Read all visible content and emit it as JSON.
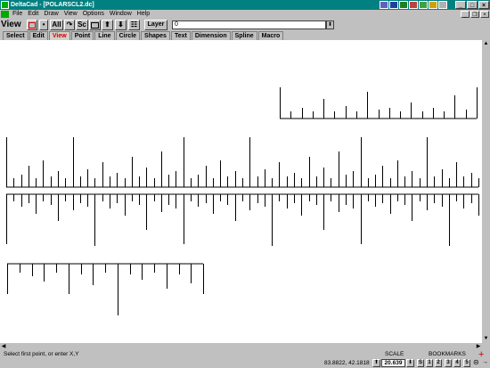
{
  "window": {
    "title": "DeltaCad - [POLARSCL2.dc]"
  },
  "menu": [
    "File",
    "Edit",
    "Draw",
    "View",
    "Options",
    "Window",
    "Help"
  ],
  "toolbar": {
    "mode_label": "View",
    "all_label": "All",
    "sc_label": "Sc",
    "layer_label": "Layer",
    "layer_value": "0",
    "dropdown_glyph": "⬍",
    "up_glyph": "⬆",
    "down_glyph": "⬇"
  },
  "tabs": [
    {
      "label": "Select",
      "active": false
    },
    {
      "label": "Edit",
      "active": false
    },
    {
      "label": "View",
      "active": true
    },
    {
      "label": "Point",
      "active": false
    },
    {
      "label": "Line",
      "active": false
    },
    {
      "label": "Circle",
      "active": false
    },
    {
      "label": "Shapes",
      "active": false
    },
    {
      "label": "Text",
      "active": false
    },
    {
      "label": "Dimension",
      "active": false
    },
    {
      "label": "Spline",
      "active": false
    },
    {
      "label": "Macro",
      "active": false
    }
  ],
  "status": {
    "prompt": "Select first point, or enter X,Y",
    "coords": "83.8822, 42.1818",
    "scale_label": "SCALE",
    "scale_value": "20.639",
    "bookmarks_label": "BOOKMARKS",
    "bookmarks": [
      "S",
      "1",
      "2",
      "3",
      "4",
      "5"
    ]
  },
  "colors": {
    "titlebar": "#008080",
    "active_tab": "#d00000",
    "canvas": "#ffffff"
  }
}
